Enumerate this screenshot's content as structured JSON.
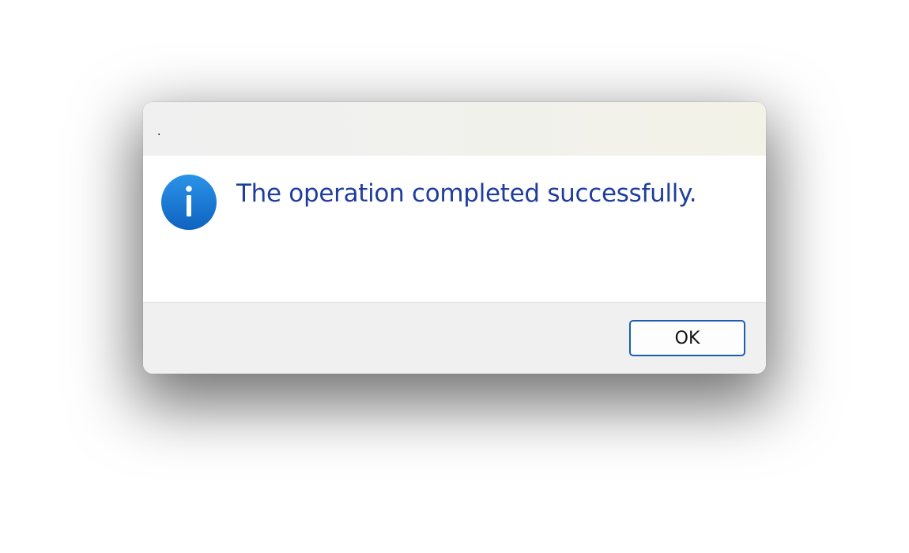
{
  "dialog": {
    "title": ".",
    "message": "The operation completed successfully.",
    "icon": "info-icon",
    "ok_label": "OK",
    "colors": {
      "message_text": "#1f3d9c",
      "icon_blue": "#1a7ad4",
      "button_border": "#1a5fb4",
      "footer_bg": "#f0f0f0"
    }
  }
}
